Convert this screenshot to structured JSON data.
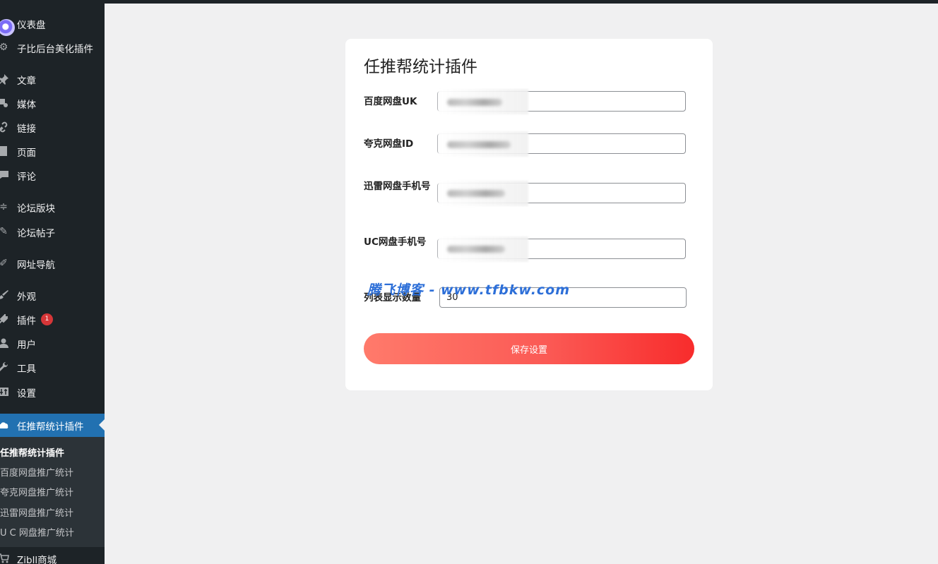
{
  "sidebar": {
    "items": [
      {
        "label": "仪表盘",
        "icon": "dashboard-icon"
      },
      {
        "label": "子比后台美化插件",
        "icon": "gear-icon"
      },
      {
        "label": "文章",
        "icon": "pin-icon"
      },
      {
        "label": "媒体",
        "icon": "media-icon"
      },
      {
        "label": "链接",
        "icon": "link-icon"
      },
      {
        "label": "页面",
        "icon": "page-icon"
      },
      {
        "label": "评论",
        "icon": "comment-icon"
      },
      {
        "label": "论坛版块",
        "icon": "forum-icon"
      },
      {
        "label": "论坛帖子",
        "icon": "post-icon"
      },
      {
        "label": "网址导航",
        "icon": "navigation-icon"
      },
      {
        "label": "外观",
        "icon": "appearance-icon"
      },
      {
        "label": "插件",
        "icon": "plugin-icon",
        "badge": "1"
      },
      {
        "label": "用户",
        "icon": "user-icon"
      },
      {
        "label": "工具",
        "icon": "wrench-icon"
      },
      {
        "label": "设置",
        "icon": "settings-icon"
      },
      {
        "label": "任推帮统计插件",
        "icon": "cloud-icon"
      },
      {
        "label": "Zibll商城",
        "icon": "cart-icon"
      }
    ],
    "submenu": [
      "任推帮统计插件",
      "百度网盘推广统计",
      "夸克网盘推广统计",
      "迅雷网盘推广统计",
      "U C 网盘推广统计"
    ]
  },
  "form": {
    "title": "任推帮统计插件",
    "fields": [
      {
        "label": "百度网盘UK",
        "value": ""
      },
      {
        "label": "夸克网盘ID",
        "value": ""
      },
      {
        "label": "迅雷网盘手机号",
        "value": ""
      },
      {
        "label": "UC网盘手机号",
        "value": ""
      },
      {
        "label": "列表显示数量",
        "value": "30"
      }
    ],
    "save_label": "保存设置"
  },
  "watermark": "腾飞博客 - www.tfbkw.com",
  "colors": {
    "sidebar_bg": "#1d2327",
    "active_bg": "#2271b1",
    "badge": "#d63638",
    "button_start": "#ff7a6b",
    "button_end": "#f82c2c"
  }
}
